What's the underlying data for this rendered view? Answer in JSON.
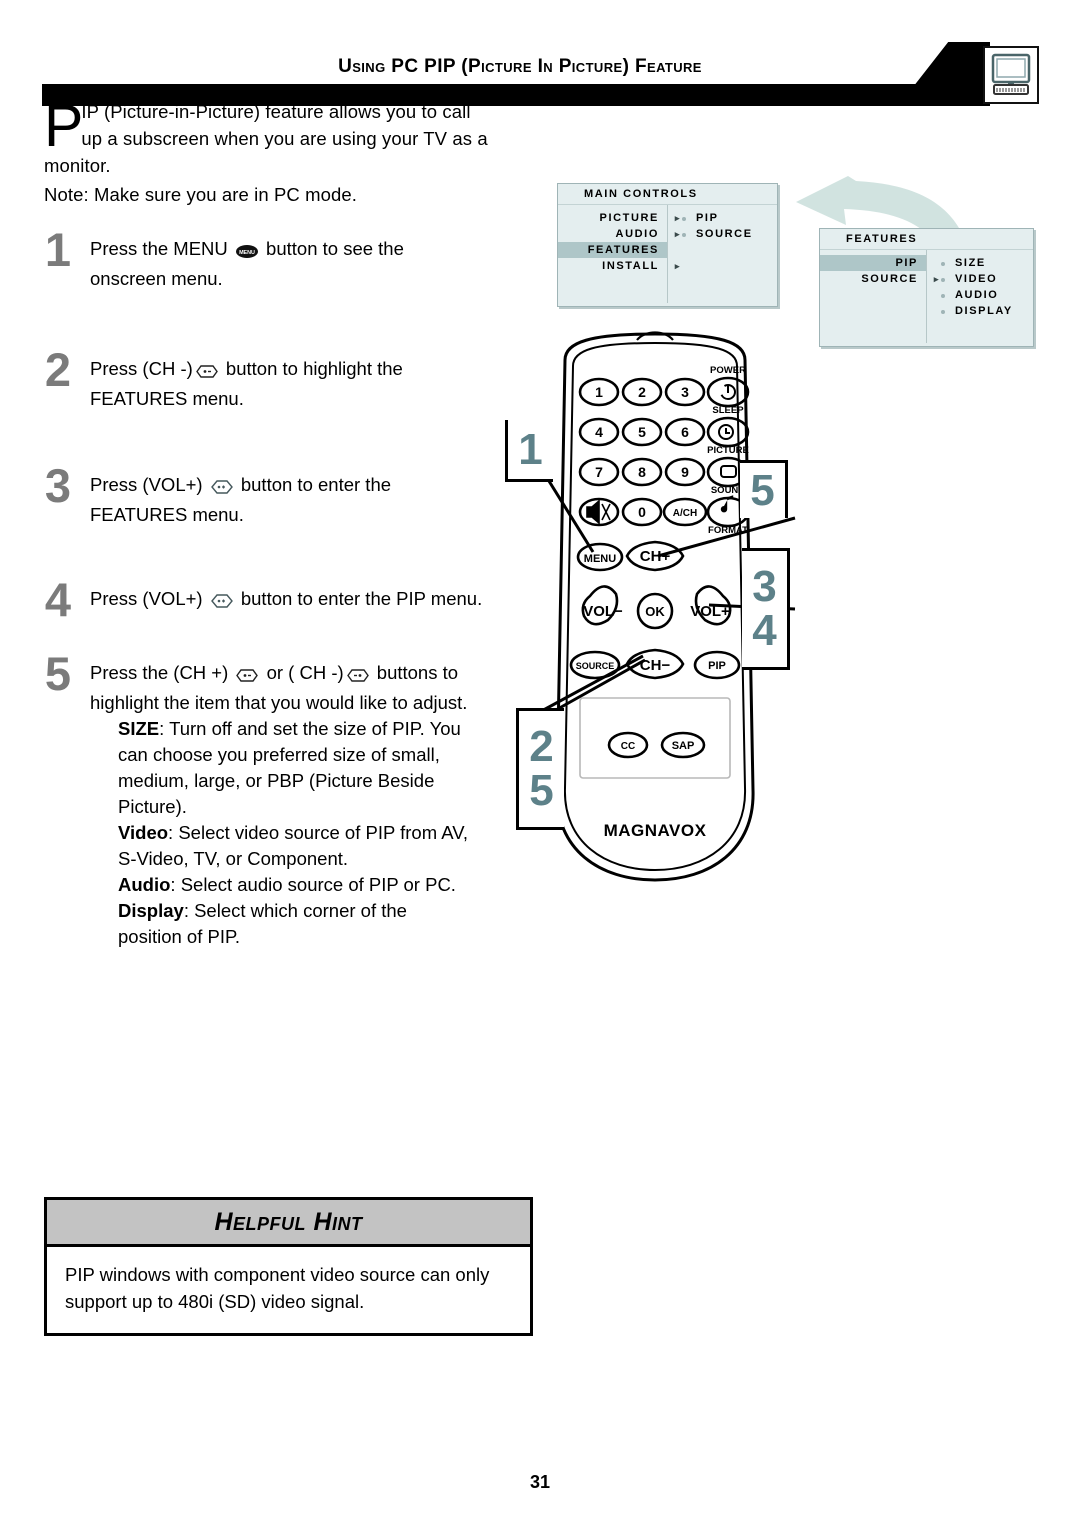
{
  "header": {
    "title": "Using PC PIP (Picture In Picture) Feature",
    "icon": "computer-monitor-icon"
  },
  "intro": {
    "dropcap": "P",
    "line1": "IP (Picture-in-Picture) feature allows you to call",
    "line2": "up a subscreen when you are using your TV as a",
    "line3": "monitor.",
    "note": "Note: Make sure you are in PC mode."
  },
  "steps": [
    {
      "num": "1",
      "pre": "Press the MENU",
      "icon": "menu-button-icon",
      "post": "button to see the",
      "line2": "onscreen menu."
    },
    {
      "num": "2",
      "pre": "Press (CH -)",
      "icon": "ch-down-button-icon",
      "post": "button to highlight the",
      "line2": "FEATURES menu."
    },
    {
      "num": "3",
      "pre": "Press (VOL+)",
      "icon": "vol-up-button-icon",
      "post": "button to enter the",
      "line2": "FEATURES menu."
    },
    {
      "num": "4",
      "pre": "Press (VOL+)",
      "icon": "vol-up-button-icon",
      "post": "button to enter the PIP menu.",
      "line2": ""
    },
    {
      "num": "5",
      "pre": "Press the  (CH +)",
      "icon": "ch-up-button-icon",
      "mid": "or ( CH -)",
      "icon2": "ch-down-button-icon",
      "post": "buttons to",
      "line2": "highlight the item that you would like to adjust."
    }
  ],
  "step5_items": [
    {
      "label": "SIZE",
      "sep": ": ",
      "text": "Turn off and set the size of PIP.  You"
    },
    {
      "label": "",
      "sep": "",
      "text": "can choose you preferred size of small,"
    },
    {
      "label": "",
      "sep": "",
      "text": "medium, large, or PBP (Picture Beside"
    },
    {
      "label": "",
      "sep": "",
      "text": "Picture)."
    },
    {
      "label": "Video",
      "sep": ": ",
      "text": "Select video source of PIP from AV,"
    },
    {
      "label": "",
      "sep": "",
      "text": "S-Video, TV, or Component."
    },
    {
      "label": "Audio",
      "sep": ": ",
      "text": "Select audio source of PIP or PC."
    },
    {
      "label": "Display",
      "sep": ": ",
      "text": "Select which corner of the"
    },
    {
      "label": "",
      "sep": "",
      "text": "position of PIP."
    }
  ],
  "osd_menus": [
    {
      "title": "MAIN CONTROLS",
      "left_items": [
        {
          "label": "PICTURE",
          "arrow": "▸",
          "highlighted": false
        },
        {
          "label": "AUDIO",
          "arrow": "▸",
          "highlighted": false
        },
        {
          "label": "FEATURES",
          "arrow": "",
          "highlighted": true
        },
        {
          "label": "INSTALL",
          "arrow": "▸",
          "highlighted": false
        }
      ],
      "right_items": [
        "PIP",
        "SOURCE"
      ]
    },
    {
      "title": "FEATURES",
      "left_items": [
        {
          "label": "PIP",
          "arrow": "",
          "highlighted": true
        },
        {
          "label": "SOURCE",
          "arrow": "▸",
          "highlighted": false
        }
      ],
      "right_items": [
        "SIZE",
        "VIDEO",
        "AUDIO",
        "DISPLAY"
      ]
    }
  ],
  "remote": {
    "brand": "MAGNAVOX",
    "keypad": [
      "1",
      "2",
      "3",
      "4",
      "5",
      "6",
      "7",
      "8",
      "9",
      "0"
    ],
    "mute_label": "MUTE",
    "ach_label": "A/CH",
    "right_column": [
      {
        "label": "POWER",
        "icon": "power-icon"
      },
      {
        "label": "SLEEP",
        "icon": "sleep-icon"
      },
      {
        "label": "PICTURE",
        "icon": "picture-icon"
      },
      {
        "label": "SOUND",
        "icon": "sound-note-icon"
      },
      {
        "label": "FORMAT",
        "icon": "format-icon"
      }
    ],
    "nav": {
      "menu": "MENU",
      "ch_up": "CH+",
      "vol_down": "VOL−",
      "ok": "OK",
      "vol_up": "VOL+",
      "source": "SOURCE",
      "ch_down": "CH−",
      "pip": "PIP"
    },
    "bottom_buttons": [
      "CC",
      "SAP"
    ]
  },
  "callouts": [
    {
      "id": "co1",
      "values": [
        "1"
      ]
    },
    {
      "id": "co5top",
      "values": [
        "5"
      ]
    },
    {
      "id": "co34",
      "values": [
        "3",
        "4"
      ]
    },
    {
      "id": "co25",
      "values": [
        "2",
        "5"
      ]
    }
  ],
  "hint": {
    "title": "Helpful Hint",
    "line1": "PIP windows with component video source can only",
    "line2": "support up to 480i (SD) video signal."
  },
  "page_number": "31",
  "colors": {
    "callout_number": "#5d8189",
    "step_number": "#7b7b7b",
    "osd_bg": "#e4eeef",
    "osd_highlight": "#aec6c8",
    "hint_header": "#c3c3c3"
  }
}
